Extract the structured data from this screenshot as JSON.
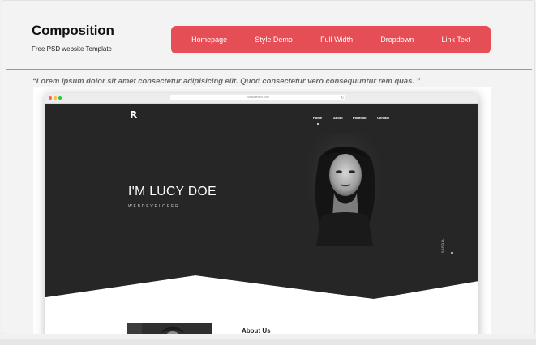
{
  "brand": {
    "title": "Composition",
    "subtitle": "Free PSD website Template"
  },
  "nav": {
    "background": "#e64e55",
    "items": [
      {
        "label": "Homepage"
      },
      {
        "label": "Style Demo"
      },
      {
        "label": "Full Width"
      },
      {
        "label": "Dropdown"
      },
      {
        "label": "Link Text"
      }
    ]
  },
  "quote": "“Lorem ipsum dolor sit amet consectetur adipisicing elit. Quod consectetur vero consequuntur rem quas. ”",
  "preview": {
    "url": "Iluxsodevelo.com",
    "site_nav": {
      "home": "Home",
      "about": "About",
      "portfolio": "Portfolio",
      "contact": "Contact"
    },
    "hero_name": "I'M LUCY DOE",
    "hero_role": "WEBDEVELOPER",
    "scroll_text": "SCROLL",
    "about_title": "About Us"
  }
}
